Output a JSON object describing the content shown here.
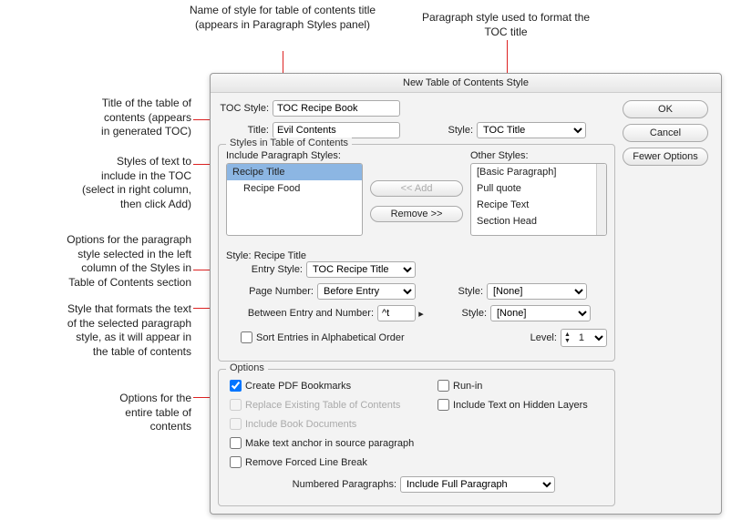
{
  "annotations": {
    "top1": "Name of style for table of contents title (appears in Paragraph Styles panel)",
    "top2": "Paragraph style used to format the TOC title",
    "left1_a": "Title of the table of",
    "left1_b": "contents (appears",
    "left1_c": "in generated TOC)",
    "left2_a": "Styles of text to",
    "left2_b": "include in the TOC",
    "left2_c": "(select in right column,",
    "left2_d": "then click Add)",
    "left3_a": "Options for the paragraph",
    "left3_b": "style selected in the left",
    "left3_c": "column of the Styles in",
    "left3_d": "Table of Contents section",
    "left4_a": "Style that formats the text",
    "left4_b": "of the selected paragraph",
    "left4_c": "style, as it will appear in",
    "left4_d": "the table of contents",
    "left5_a": "Options for the",
    "left5_b": "entire table of",
    "left5_c": "contents"
  },
  "dialog": {
    "title": "New Table of Contents Style",
    "buttons": {
      "ok": "OK",
      "cancel": "Cancel",
      "fewer": "Fewer Options"
    },
    "tocStyle": {
      "label": "TOC Style:",
      "value": "TOC Recipe Book"
    },
    "titleField": {
      "label": "Title:",
      "value": "Evil Contents"
    },
    "styleDrop": {
      "label": "Style:",
      "value": "TOC Title"
    },
    "stylesSection": {
      "legend": "Styles in Table of Contents",
      "includeLabel": "Include Paragraph Styles:",
      "otherLabel": "Other Styles:",
      "include": [
        "Recipe Title",
        "Recipe Food"
      ],
      "other": [
        "[Basic Paragraph]",
        "Pull quote",
        "Recipe Text",
        "Section Head"
      ],
      "addBtn": "<< Add",
      "removeBtn": "Remove >>"
    },
    "entrySection": {
      "selectedStyle": "Style: Recipe Title",
      "entryStyleLabel": "Entry Style:",
      "entryStyleValue": "TOC Recipe Title",
      "pageNumLabel": "Page Number:",
      "pageNumValue": "Before Entry",
      "pageNumStyleLabel": "Style:",
      "pageNumStyleValue": "[None]",
      "betweenLabel": "Between Entry and Number:",
      "betweenValue": "^t",
      "betweenStyleLabel": "Style:",
      "betweenStyleValue": "[None]",
      "sortLabel": "Sort Entries in Alphabetical Order",
      "levelLabel": "Level:",
      "levelValue": "1"
    },
    "options": {
      "legend": "Options",
      "pdfBookmarks": "Create PDF Bookmarks",
      "replace": "Replace Existing Table of Contents",
      "includeBook": "Include Book Documents",
      "anchor": "Make text anchor in source paragraph",
      "removeBreak": "Remove Forced Line Break",
      "runin": "Run-in",
      "hidden": "Include Text on Hidden Layers",
      "numberedLabel": "Numbered Paragraphs:",
      "numberedValue": "Include Full Paragraph"
    }
  }
}
